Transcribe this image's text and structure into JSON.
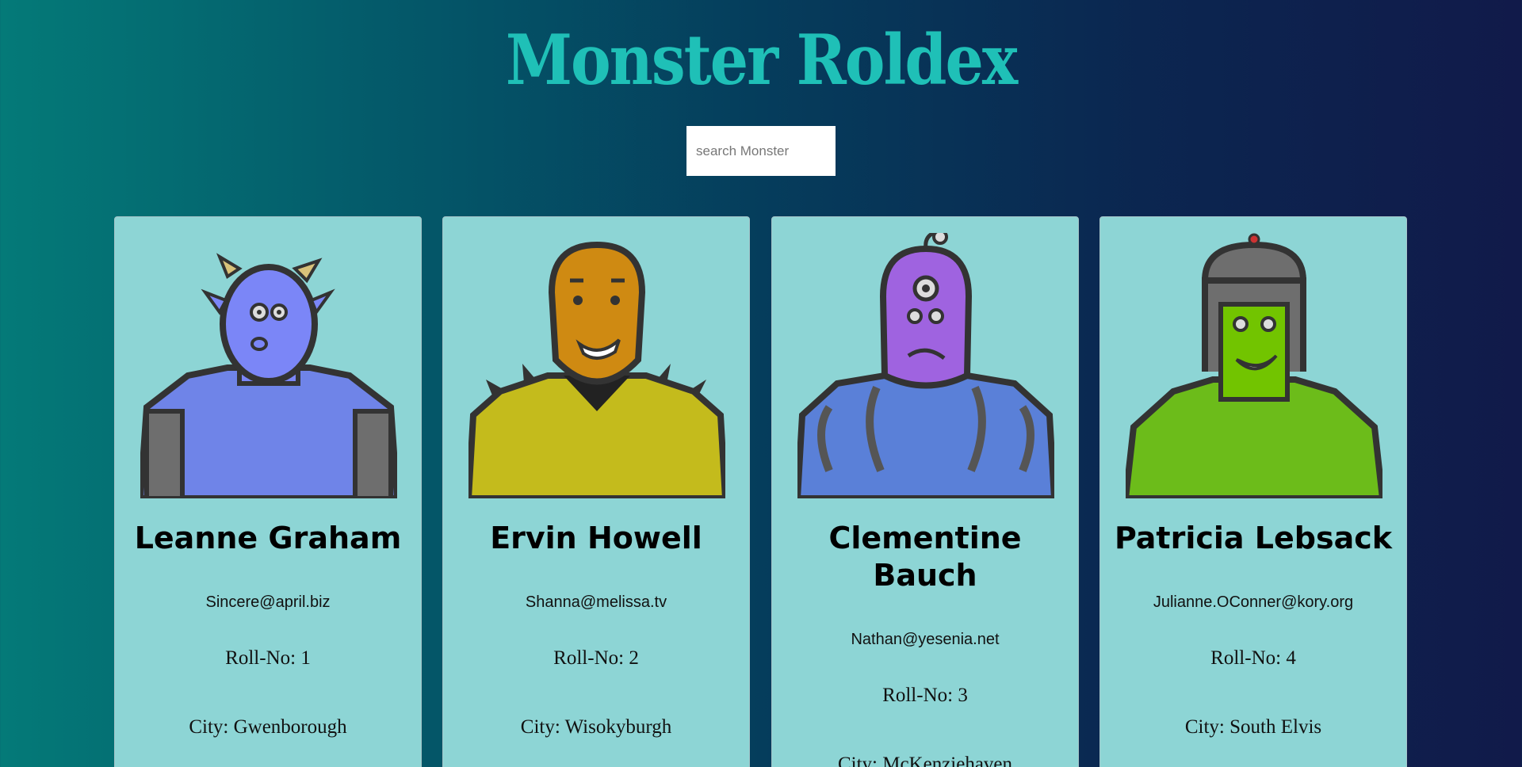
{
  "header": {
    "title": "Monster Roldex"
  },
  "search": {
    "placeholder": "search Monster",
    "value": ""
  },
  "monsters": [
    {
      "name": "Leanne Graham",
      "email": "Sincere@april.biz",
      "roll": "Roll-No: 1",
      "city": "City: Gwenborough",
      "color": "#7b86f7"
    },
    {
      "name": "Ervin Howell",
      "email": "Shanna@melissa.tv",
      "roll": "Roll-No: 2",
      "city": "City: Wisokyburgh",
      "color": "#d3c200"
    },
    {
      "name": "Clementine Bauch",
      "email": "Nathan@yesenia.net",
      "roll": "Roll-No: 3",
      "city": "City: McKenziehaven",
      "color": "#9f63e0"
    },
    {
      "name": "Patricia Lebsack",
      "email": "Julianne.OConner@kory.org",
      "roll": "Roll-No: 4",
      "city": "City: South Elvis",
      "color": "#72c400"
    }
  ],
  "colors": {
    "title": "#1fc0b7",
    "card_bg": "#8dd5d5"
  }
}
